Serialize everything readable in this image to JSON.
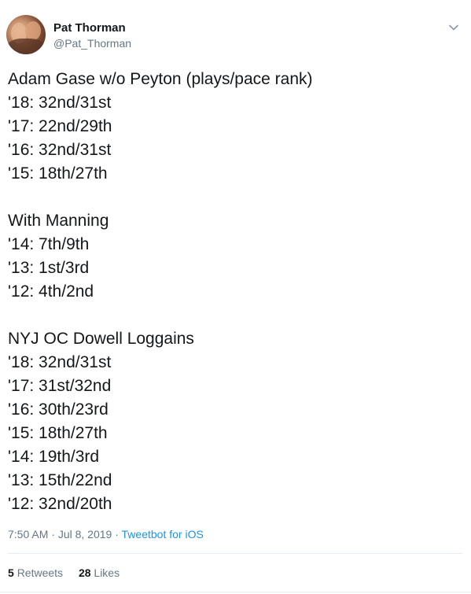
{
  "user": {
    "display_name": "Pat Thorman",
    "handle": "@Pat_Thorman"
  },
  "tweet": {
    "text": "Adam Gase w/o Peyton (plays/pace rank)\n'18: 32nd/31st\n'17: 22nd/29th\n'16: 32nd/31st\n'15: 18th/27th\n\nWith Manning\n'14: 7th/9th\n'13: 1st/3rd\n'12: 4th/2nd\n\nNYJ OC Dowell Loggains\n'18: 32nd/31st\n'17: 31st/32nd\n'16: 30th/23rd\n'15: 18th/27th\n'14: 19th/3rd\n'13: 15th/22nd\n'12: 32nd/20th",
    "time": "7:50 AM",
    "separator": " · ",
    "date": "Jul 8, 2019",
    "source": "Tweetbot for iOS"
  },
  "stats": {
    "retweets_count": "5",
    "retweets_label": "Retweets",
    "likes_count": "28",
    "likes_label": "Likes"
  },
  "icons": {
    "caret": "chevron-down-icon",
    "avatar": "avatar"
  },
  "colors": {
    "text": "#14171a",
    "muted": "#657786",
    "link": "#1b95e0",
    "divider": "#e6ecf0"
  }
}
